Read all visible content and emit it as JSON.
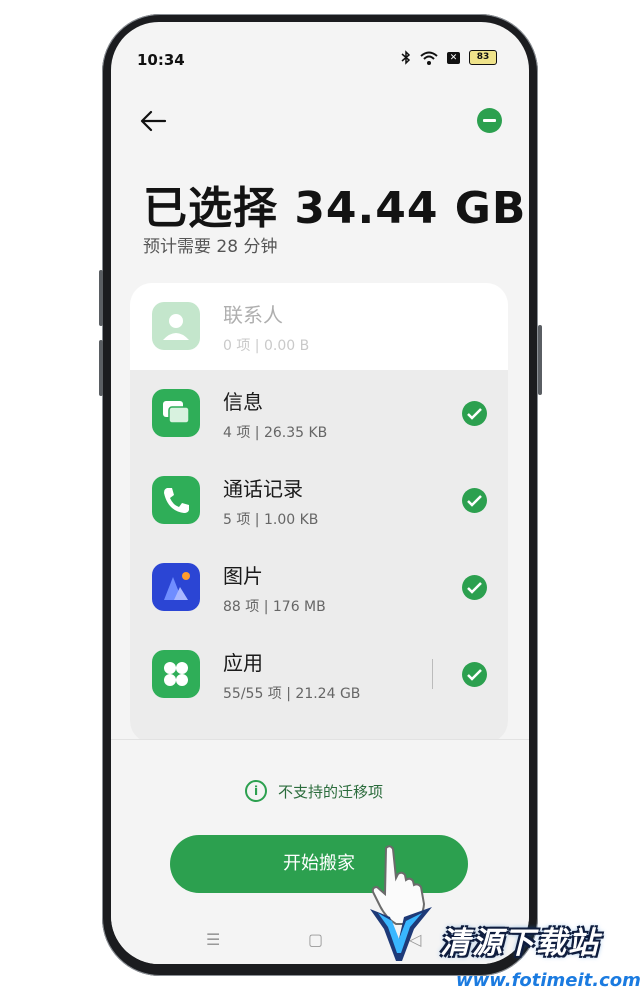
{
  "status_bar": {
    "time": "10:34",
    "battery": "83",
    "icons": [
      "bluetooth-icon",
      "wifi-icon",
      "x-icon",
      "battery-icon"
    ]
  },
  "header": {
    "title": "已选择 34.44  GB",
    "subtitle": "预计需要 28 分钟"
  },
  "items": [
    {
      "name": "联系人",
      "meta": "0 项 | 0.00  B",
      "icon": "contacts-icon",
      "checked": false
    },
    {
      "name": "信息",
      "meta": "4 项 | 26.35  KB",
      "icon": "messages-icon",
      "checked": true
    },
    {
      "name": "通话记录",
      "meta": "5 项 | 1.00  KB",
      "icon": "phone-icon",
      "checked": true
    },
    {
      "name": "图片",
      "meta": "88 项 | 176  MB",
      "icon": "gallery-icon",
      "checked": true
    },
    {
      "name": "应用",
      "meta": "55/55 项 | 21.24  GB",
      "icon": "apps-icon",
      "checked": true
    }
  ],
  "footer": {
    "unsupported_label": "不支持的迁移项",
    "start_button": "开始搬家"
  },
  "watermark": {
    "text": "清源下载站",
    "url": "www.fotimeit.com"
  },
  "colors": {
    "accent": "#2ca04f",
    "background": "#f4f4f4"
  }
}
